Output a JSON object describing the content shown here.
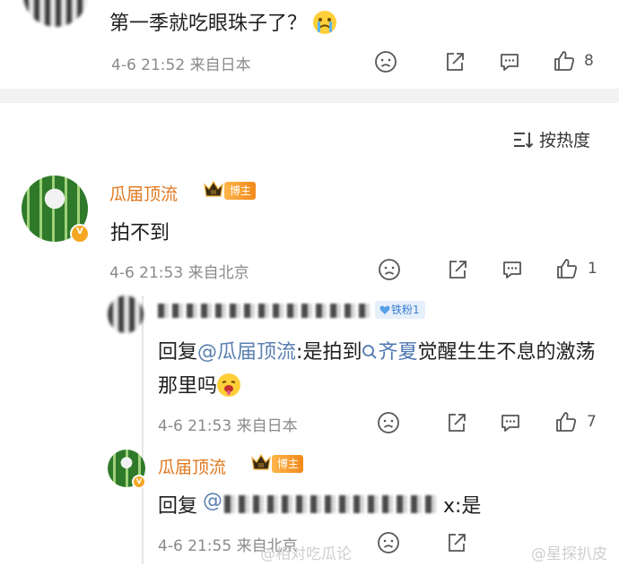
{
  "top_comment": {
    "text": "第一季就吃眼珠子了？",
    "emoji": "crying-emoji",
    "meta": "4-6 21:52 来自日本",
    "like_count": "8"
  },
  "sort": {
    "label": "按热度"
  },
  "main_comment": {
    "user_name": "瓜届顶流",
    "badge": "博主",
    "text": "拍不到",
    "meta": "4-6 21:53 来自北京",
    "like_count": "1"
  },
  "reply_1": {
    "fan_badge": "铁粉1",
    "prefix": "回复",
    "mention": "@瓜届顶流",
    "text_a": ":是拍到",
    "topic": "齐夏",
    "text_b": "觉醒生生不息的激荡那里吗",
    "emoji": "drooling-emoji",
    "meta": "4-6 21:53 来自日本",
    "like_count": "7"
  },
  "reply_2": {
    "user_name": "瓜届顶流",
    "badge": "博主",
    "prefix": "回复",
    "mention_at": "@",
    "suffix": "x:是",
    "meta": "4-6 21:55 来自北京"
  },
  "watermarks": {
    "left": "@相对吃瓜论",
    "right": "@星探扒皮"
  },
  "colors": {
    "name_orange": "#e0771f",
    "link_blue": "#5a7fb0",
    "badge_orange": "#f2891b"
  }
}
